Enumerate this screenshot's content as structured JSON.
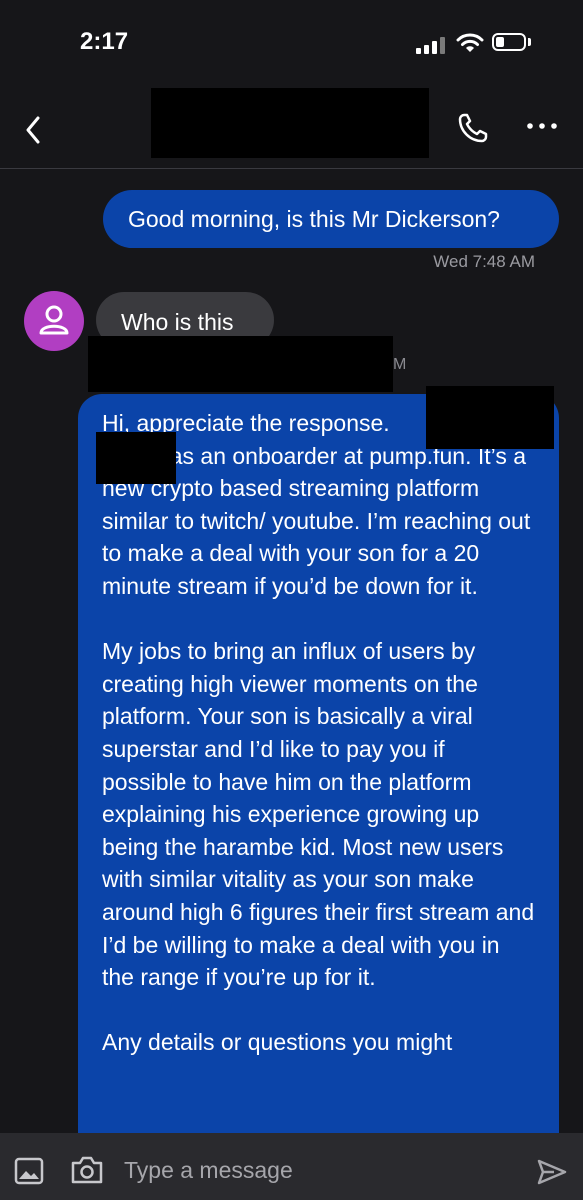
{
  "status": {
    "time": "2:17"
  },
  "header": {
    "back_icon": "chevron-left-icon",
    "call_icon": "phone-icon",
    "more_icon": "more-horizontal-icon"
  },
  "messages": [
    {
      "direction": "outgoing",
      "text": "Good morning, is this Mr Dickerson?",
      "timestamp": "Wed 7:48 AM"
    },
    {
      "direction": "incoming",
      "text": "Who is this",
      "redacted_fragment": "M"
    },
    {
      "direction": "outgoing",
      "text": "Hi, appreciate the response.\n          I work as an onboarder at pump.fun. It’s a new crypto based streaming platform similar to twitch/ youtube. I’m reaching out to make a deal with your son for a 20 minute stream if you’d be down for it.\n\nMy jobs to bring an influx of users by creating high viewer moments on the platform. Your son is basically a viral superstar and I’d like to pay you if possible to have him on the platform explaining his experience growing up being the harambe kid. Most new users with similar vitality as your son make around high 6 figures their first stream and I’d be willing to make a deal with you in the range if you’re up for it.\n\nAny details or questions you might"
    }
  ],
  "composer": {
    "placeholder": "Type a message",
    "gallery_icon": "gallery-icon",
    "camera_icon": "camera-icon",
    "send_icon": "send-icon"
  },
  "colors": {
    "background": "#161619",
    "outgoing_bubble": "#0b44a9",
    "incoming_bubble": "#3a3a3e",
    "avatar": "#b13ec2"
  }
}
